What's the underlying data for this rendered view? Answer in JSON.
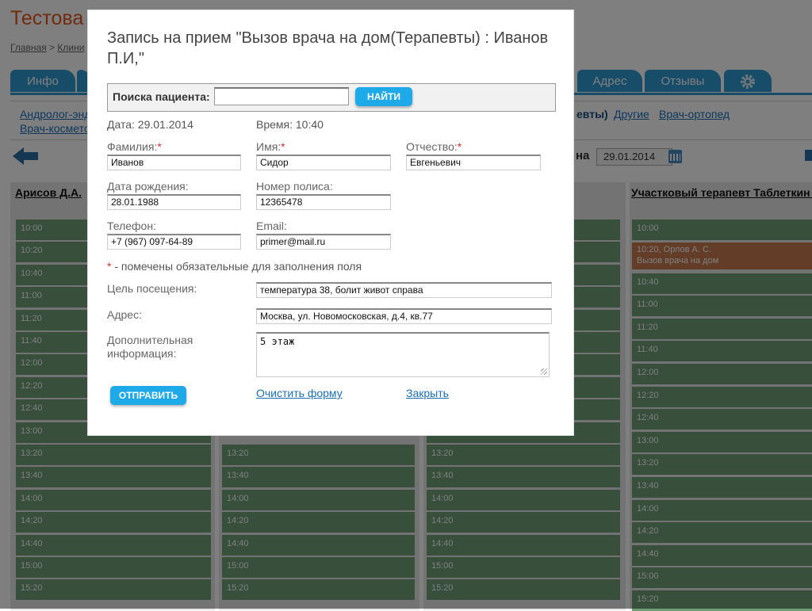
{
  "site": {
    "title": "Тестова",
    "breadcrumb": [
      "Главная",
      "Клини"
    ]
  },
  "tabs": [
    {
      "label": "Инфо"
    },
    {
      "label": "Адрес"
    },
    {
      "label": "Отзывы"
    },
    {
      "label": "settings",
      "icon": "gear-icon"
    }
  ],
  "specialties": {
    "row1_left": "Андролог-энд",
    "row1_right_partial": "евты)",
    "row1_other": "Другие",
    "row1_ortho": "Врач-ортопед",
    "row2_left": "Врач-космето"
  },
  "schedule": {
    "date_label": "на",
    "date_value": "29.01.2014",
    "doctors": [
      {
        "name": "Арисов Д.А."
      },
      {
        "name": "Участковый терапевт Таблеткин Иван Владимирович"
      }
    ],
    "col1_times": [
      "10:00",
      "10:20",
      "10:40",
      "11:00",
      "11:20",
      "11:40",
      "12:00",
      "12:20",
      "12:40",
      "13:00",
      "13:20",
      "13:40",
      "14:00",
      "14:20",
      "14:40",
      "15:00",
      "15:20"
    ],
    "col23_times": [
      "13:20",
      "13:40",
      "14:00",
      "14:20",
      "14:40",
      "15:00",
      "15:20"
    ],
    "col4_slots": [
      {
        "time": "10:00"
      },
      {
        "time": "10:20, Орлов А. С.",
        "note": "Вызов врача на дом",
        "booked": true
      },
      {
        "time": "10:40"
      },
      {
        "time": "11:00"
      },
      {
        "time": "11:20"
      },
      {
        "time": "11:40"
      },
      {
        "time": "12:00"
      },
      {
        "time": "12:20"
      },
      {
        "time": "12:40"
      },
      {
        "time": "13:00"
      },
      {
        "time": "13:20"
      },
      {
        "time": "13:40"
      },
      {
        "time": "14:00"
      },
      {
        "time": "14:20"
      },
      {
        "time": "14:40"
      },
      {
        "time": "15:00"
      },
      {
        "time": "15:20"
      }
    ]
  },
  "modal": {
    "title": "Запись на прием \"Вызов врача на дом(Терапевты) : Иванов П.И,\"",
    "search_label": "Поиска пациента:",
    "search_value": "",
    "find_button": "НАЙТИ",
    "date_text": "Дата: 29.01.2014",
    "time_text": "Время: 10:40",
    "labels": {
      "surname": "Фамилия:",
      "name": "Имя:",
      "patronymic": "Отчество:",
      "birthdate": "Дата рождения:",
      "policy": "Номер полиса:",
      "phone": "Телефон:",
      "email": "Email:",
      "purpose": "Цель посещения:",
      "address": "Адрес:",
      "extra": "Дополнительная информация:"
    },
    "required_mark": "*",
    "values": {
      "surname": "Иванов",
      "name": "Сидор",
      "patronymic": "Евгеньевич",
      "birthdate": "28.01.1988",
      "policy": "12365478",
      "phone": "+7 (967) 097-64-89",
      "email": "primer@mail.ru",
      "purpose": "температура 38, болит живот справа",
      "address": "Москва, ул. Новомосковская, д.4, кв.77",
      "extra": "5 этаж"
    },
    "required_note": "- помечены обязательные для заполнения поля",
    "submit_button": "ОТПРАВИТЬ",
    "clear_link": "Очистить форму",
    "close_link": "Закрыть"
  }
}
